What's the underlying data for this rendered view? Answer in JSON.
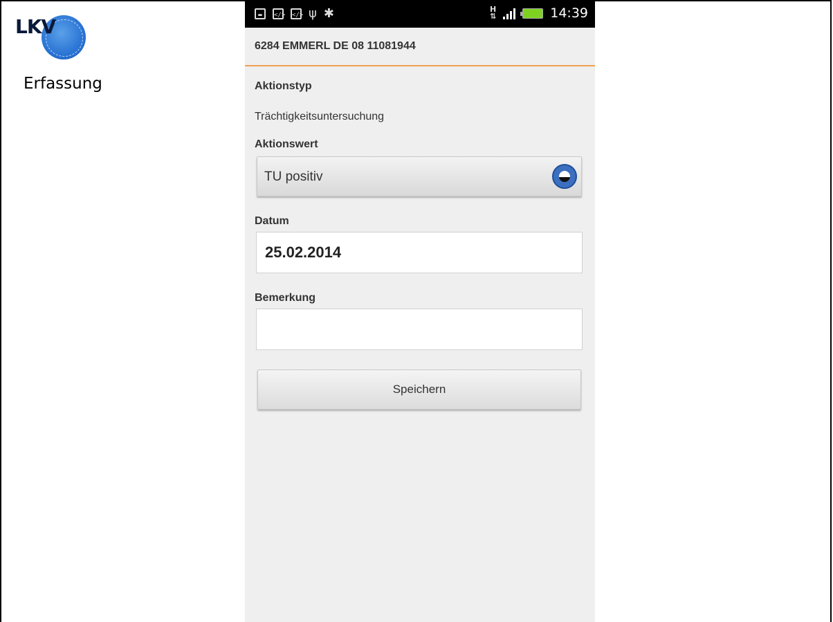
{
  "slide": {
    "logo_text": "LKV",
    "label": "Erfassung"
  },
  "statusbar": {
    "icons_left": [
      "keyboard-icon",
      "code-icon",
      "code-icon",
      "usb-icon",
      "android-debug-icon"
    ],
    "network_type": "H",
    "time": "14:39"
  },
  "header": {
    "title": "6284 EMMERL DE 08 11081944"
  },
  "form": {
    "aktionstyp_label": "Aktionstyp",
    "aktionstyp_value": "Trächtigkeitsuntersuchung",
    "aktionswert_label": "Aktionswert",
    "aktionswert_value": "TU positiv",
    "datum_label": "Datum",
    "datum_value": "25.02.2014",
    "bemerkung_label": "Bemerkung",
    "bemerkung_value": "",
    "save_label": "Speichern"
  },
  "colors": {
    "accent_orange": "#f0a050",
    "knob_blue": "#3c6fbf",
    "battery_green": "#7ed321"
  }
}
